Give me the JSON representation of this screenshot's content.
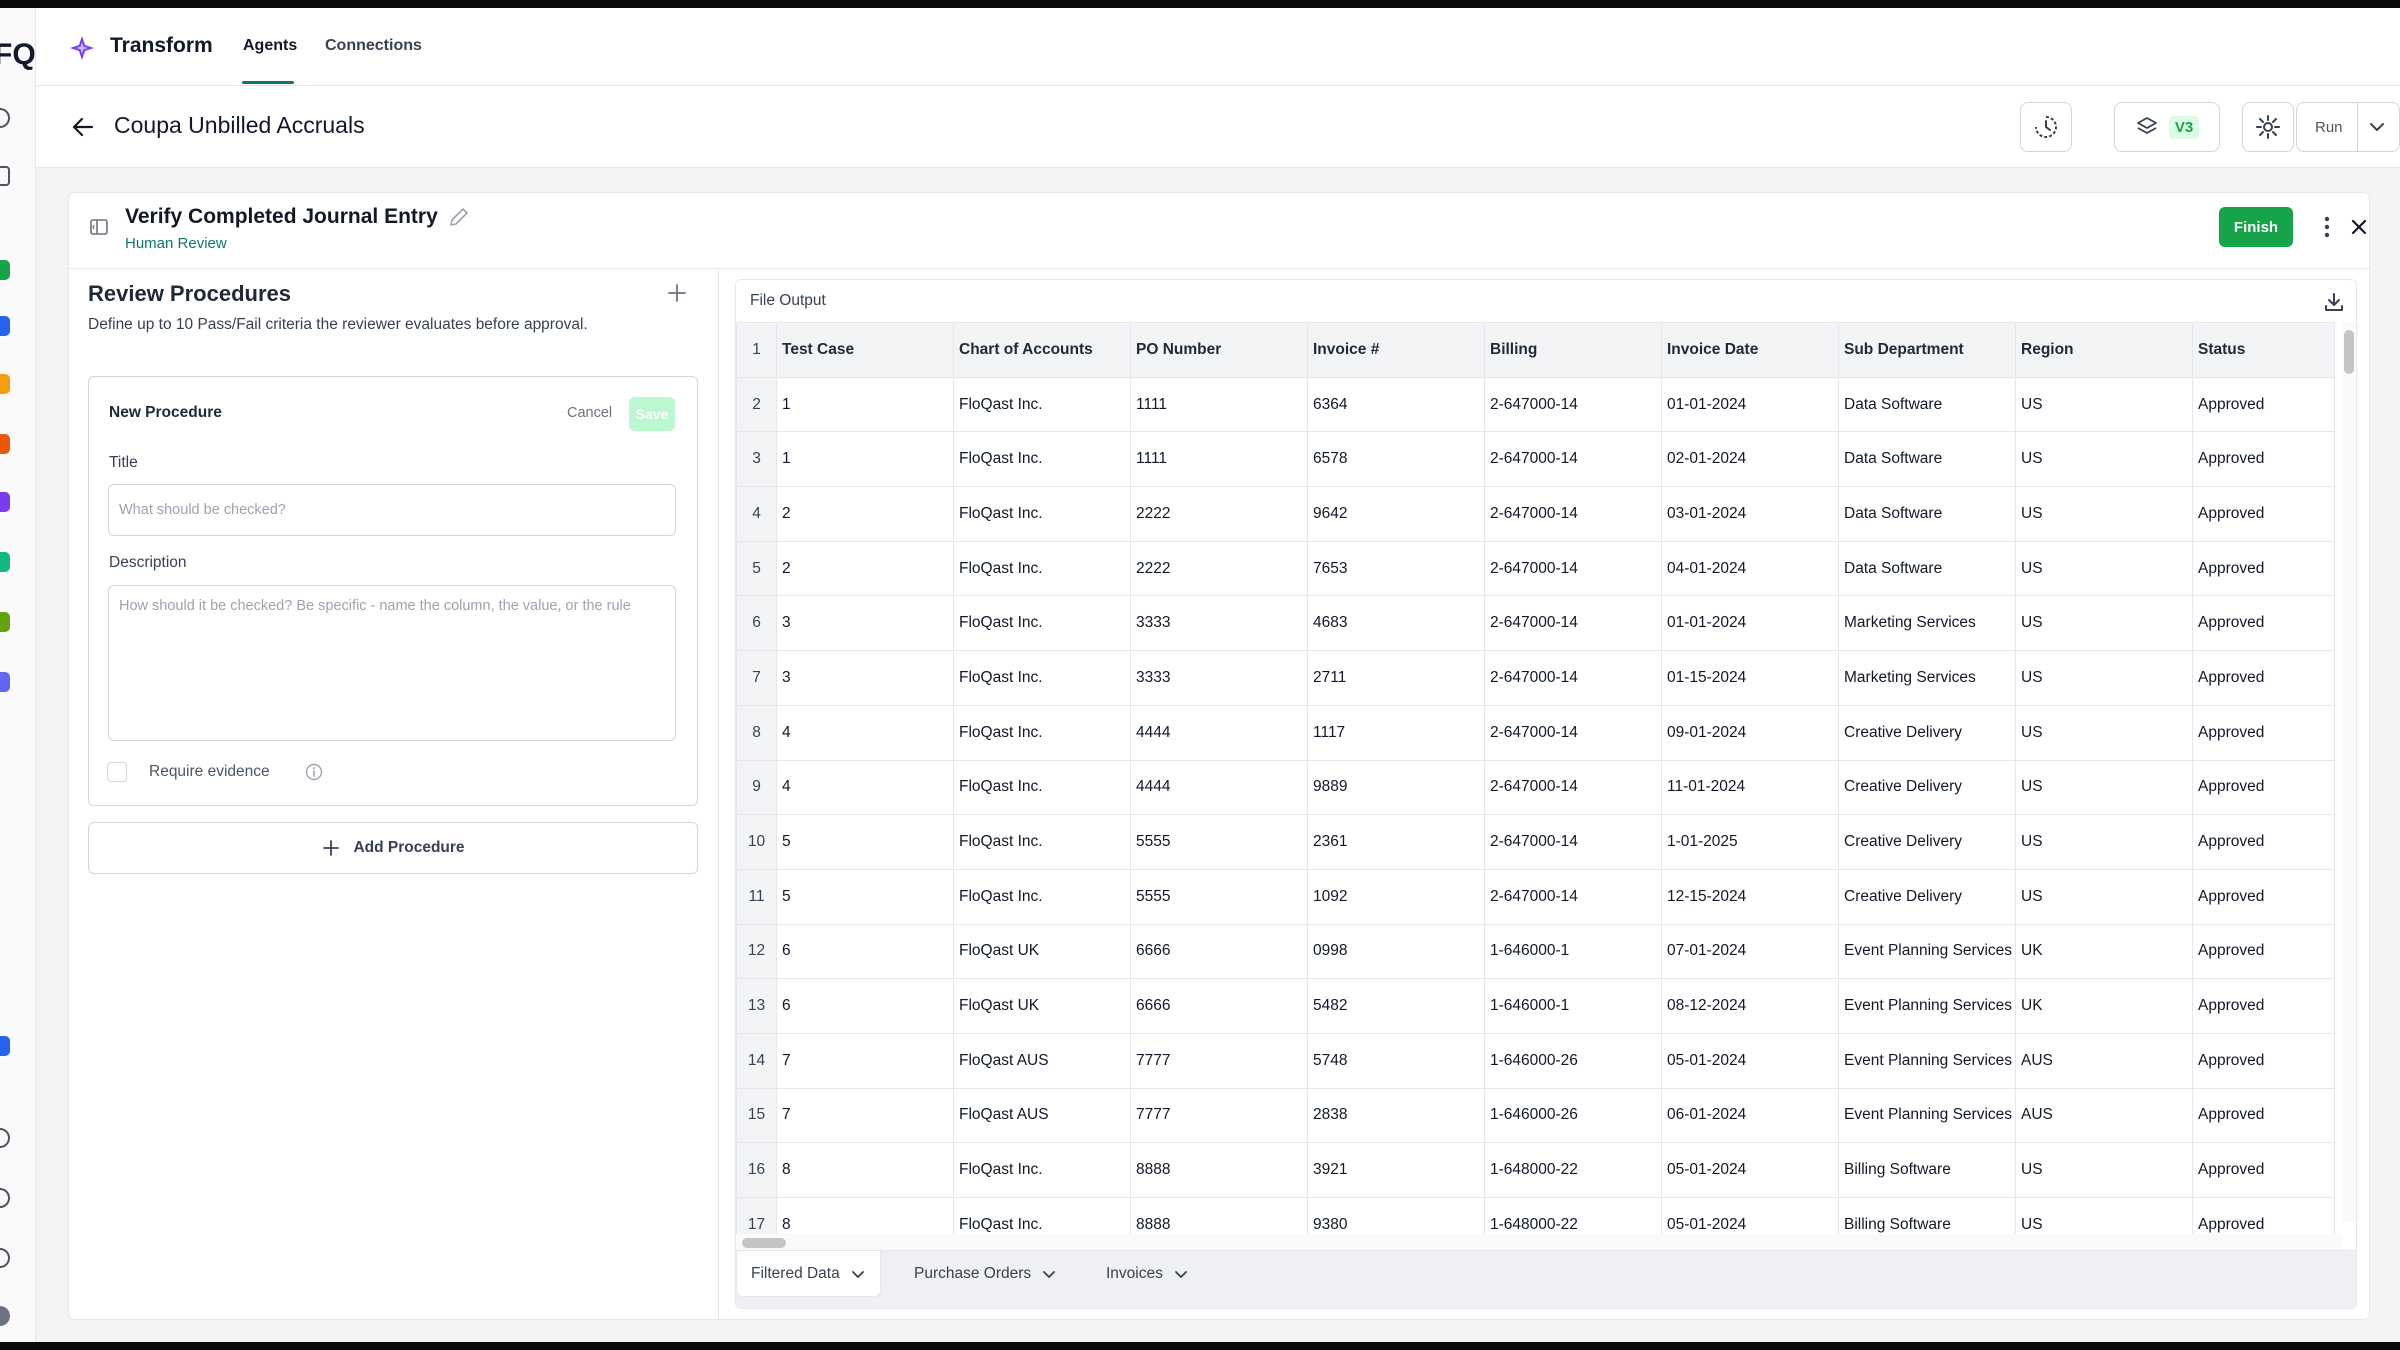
{
  "rail": {
    "logo_text": "FQ"
  },
  "app": {
    "name": "Transform",
    "tabs": [
      {
        "label": "Agents"
      },
      {
        "label": "Connections"
      }
    ]
  },
  "page": {
    "title": "Coupa Unbilled Accruals",
    "version_badge": "V3",
    "run_label": "Run"
  },
  "step": {
    "title": "Verify Completed Journal Entry",
    "subtitle": "Human Review",
    "finish_label": "Finish"
  },
  "review": {
    "title": "Review Procedures",
    "description": "Define up to 10 Pass/Fail criteria the reviewer evaluates before approval.",
    "new_procedure": {
      "heading": "New Procedure",
      "cancel_label": "Cancel",
      "save_label": "Save",
      "title_label": "Title",
      "title_placeholder": "What should be checked?",
      "description_label": "Description",
      "description_placeholder": "How should it be checked? Be specific - name the column, the value, or the rule",
      "evidence_label": "Require evidence"
    },
    "add_procedure_label": "Add Procedure"
  },
  "file_output": {
    "title": "File Output",
    "header_row_number": "1",
    "columns": [
      "Test Case",
      "Chart of Accounts",
      "PO Number",
      "Invoice #",
      "Billing",
      "Invoice Date",
      "Sub Department",
      "Region",
      "Status"
    ],
    "rows": [
      {
        "n": "2",
        "cells": [
          "1",
          "FloQast Inc.",
          "1111",
          "6364",
          "2-647000-14",
          "01-01-2024",
          "Data Software",
          "US",
          "Approved"
        ]
      },
      {
        "n": "3",
        "cells": [
          "1",
          "FloQast Inc.",
          "1111",
          "6578",
          "2-647000-14",
          "02-01-2024",
          "Data Software",
          "US",
          "Approved"
        ]
      },
      {
        "n": "4",
        "cells": [
          "2",
          "FloQast Inc.",
          "2222",
          "9642",
          "2-647000-14",
          "03-01-2024",
          "Data Software",
          "US",
          "Approved"
        ]
      },
      {
        "n": "5",
        "cells": [
          "2",
          "FloQast Inc.",
          "2222",
          "7653",
          "2-647000-14",
          "04-01-2024",
          "Data Software",
          "US",
          "Approved"
        ]
      },
      {
        "n": "6",
        "cells": [
          "3",
          "FloQast Inc.",
          "3333",
          "4683",
          "2-647000-14",
          "01-01-2024",
          "Marketing Services",
          "US",
          "Approved"
        ]
      },
      {
        "n": "7",
        "cells": [
          "3",
          "FloQast Inc.",
          "3333",
          "2711",
          "2-647000-14",
          "01-15-2024",
          "Marketing Services",
          "US",
          "Approved"
        ]
      },
      {
        "n": "8",
        "cells": [
          "4",
          "FloQast Inc.",
          "4444",
          "1117",
          "2-647000-14",
          "09-01-2024",
          "Creative Delivery",
          "US",
          "Approved"
        ]
      },
      {
        "n": "9",
        "cells": [
          "4",
          "FloQast Inc.",
          "4444",
          "9889",
          "2-647000-14",
          "11-01-2024",
          "Creative Delivery",
          "US",
          "Approved"
        ]
      },
      {
        "n": "10",
        "cells": [
          "5",
          "FloQast Inc.",
          "5555",
          "2361",
          "2-647000-14",
          "1-01-2025",
          "Creative Delivery",
          "US",
          "Approved"
        ]
      },
      {
        "n": "11",
        "cells": [
          "5",
          "FloQast Inc.",
          "5555",
          "1092",
          "2-647000-14",
          "12-15-2024",
          "Creative Delivery",
          "US",
          "Approved"
        ]
      },
      {
        "n": "12",
        "cells": [
          "6",
          "FloQast UK",
          "6666",
          "0998",
          "1-646000-1",
          "07-01-2024",
          "Event Planning Services",
          "UK",
          "Approved"
        ]
      },
      {
        "n": "13",
        "cells": [
          "6",
          "FloQast UK",
          "6666",
          "5482",
          "1-646000-1",
          "08-12-2024",
          "Event Planning Services",
          "UK",
          "Approved"
        ]
      },
      {
        "n": "14",
        "cells": [
          "7",
          "FloQast AUS",
          "7777",
          "5748",
          "1-646000-26",
          "05-01-2024",
          "Event Planning Services",
          "AUS",
          "Approved"
        ]
      },
      {
        "n": "15",
        "cells": [
          "7",
          "FloQast AUS",
          "7777",
          "2838",
          "1-646000-26",
          "06-01-2024",
          "Event Planning Services",
          "AUS",
          "Approved"
        ]
      },
      {
        "n": "16",
        "cells": [
          "8",
          "FloQast Inc.",
          "8888",
          "3921",
          "1-648000-22",
          "05-01-2024",
          "Billing Software",
          "US",
          "Approved"
        ]
      },
      {
        "n": "17",
        "cells": [
          "8",
          "FloQast Inc.",
          "8888",
          "9380",
          "1-648000-22",
          "05-01-2024",
          "Billing Software",
          "US",
          "Approved"
        ]
      }
    ],
    "sheets": [
      {
        "label": "Filtered Data"
      },
      {
        "label": "Purchase Orders"
      },
      {
        "label": "Invoices"
      }
    ]
  },
  "colors": {
    "accent": "#16a34a",
    "teal": "#0f766e",
    "brand_purple": "#7c3aed"
  }
}
